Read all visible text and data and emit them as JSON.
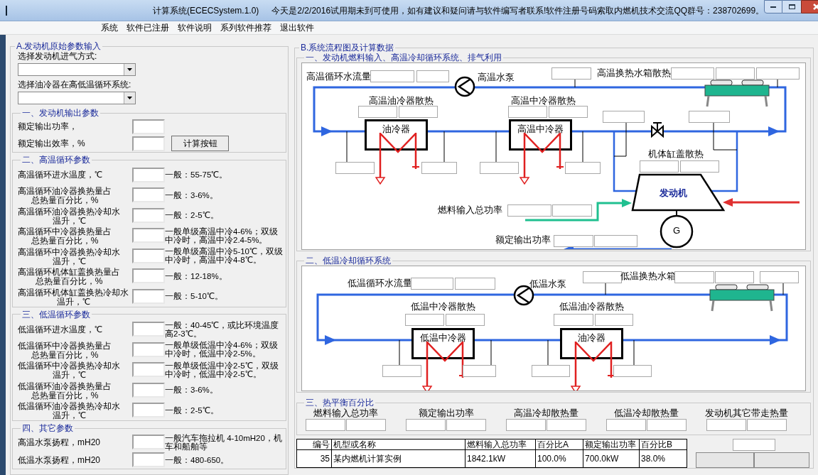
{
  "window": {
    "title": "计算系统(ECECSystem.1.0)",
    "notice": "今天是2/2/2016试用期未到可使用，如有建议和疑问请与软件编写者联系!软件注册号码索取内燃机技术交流QQ群号：238702699。"
  },
  "menu": [
    "系统",
    "软件已注册",
    "软件说明",
    "系列软件推荐",
    "退出软件"
  ],
  "input_panel": {
    "title": "A.发动机原始参数输入",
    "selects": [
      {
        "label": "选择发动机进气方式:"
      },
      {
        "label": "选择油冷器在高低温循环系统:"
      }
    ],
    "groups": [
      {
        "title": "一、发动机输出参数",
        "rows": [
          {
            "label": [
              "额定输出功率，"
            ]
          },
          {
            "label": [
              "额定输出效率，%"
            ],
            "button": "计算按钮"
          }
        ]
      },
      {
        "title": "二、高温循环参数",
        "rows": [
          {
            "label": [
              "高温循环进水温度，℃"
            ],
            "hint": "一般：55-75℃。"
          },
          {
            "label": [
              "高温循环油冷器换热量占",
              "总热量百分比，%"
            ],
            "hint": "一般：3-6%。"
          },
          {
            "label": [
              "高温循环油冷器换热冷却水",
              "温升，℃"
            ],
            "hint": "一般：2-5℃。"
          },
          {
            "label": [
              "高温循环中冷器换热量占",
              "总热量百分比，%"
            ],
            "hint": "一般单级高温中冷4-6%；双级中冷时，高温中冷2.4-5%。"
          },
          {
            "label": [
              "高温循环中冷器换热冷却水",
              "温升，℃"
            ],
            "hint": "一般单级高温中冷5-10℃，双级中冷时，高温中冷4-8℃。"
          },
          {
            "label": [
              "高温循环机体缸盖换热量占",
              "总热量百分比，%"
            ],
            "hint": "一般：12-18%。"
          },
          {
            "label": [
              "高温循环机体缸盖换热冷却水",
              "温升，℃"
            ],
            "hint": "一般：5-10℃。"
          }
        ]
      },
      {
        "title": "三、低温循环参数",
        "rows": [
          {
            "label": [
              "低温循环进水温度，℃"
            ],
            "hint": "一般：40-45℃，或比环境温度高2-3℃。"
          },
          {
            "label": [
              "低温循环中冷器换热量占",
              "总热量百分比，%"
            ],
            "hint": "一般单级低温中冷4-6%；双级中冷时，低温中冷2-5%。"
          },
          {
            "label": [
              "低温循环中冷器换热冷却水",
              "温升，℃"
            ],
            "hint": "一般单级低温中冷2-5℃，双级中冷时，低温中冷2-5℃。"
          },
          {
            "label": [
              "低温循环油冷器换热量占",
              "总热量百分比，%"
            ],
            "hint": "一般：3-6%。"
          },
          {
            "label": [
              "低温循环油冷器换热冷却水",
              "温升，℃"
            ],
            "hint": "一般：2-5℃。"
          }
        ]
      },
      {
        "title": "四、其它参数",
        "rows": [
          {
            "label": [
              "高温水泵扬程，mH20"
            ],
            "hint": "一般汽车拖拉机 4-10mH20，机车和船舶等"
          },
          {
            "label": [
              "低温水泵扬程，mH20"
            ],
            "hint": "一般：480-650。"
          }
        ]
      }
    ]
  },
  "diagram": {
    "title": "B.系统流程图及计算数据",
    "high_temp": {
      "title": "一、发动机燃料输入、高温冷却循环系统、排气利用",
      "flow_label": "高温循环水流量",
      "pump_label": "高温水泵",
      "radiator_label": "高温换热水箱散热",
      "cooler_1_label": "高温油冷器散热",
      "cooler_1_name": "油冷器",
      "cooler_2_label": "高温中冷器散热",
      "cooler_2_name": "高温中冷器",
      "block_label": "机体缸盖散热",
      "engine_name": "发动机",
      "fuel_label": "燃料输入总功率",
      "output_label": "额定输出功率",
      "generator": "G"
    },
    "low_temp": {
      "title": "二、低温冷却循环系统",
      "flow_label": "低温循环水流量",
      "pump_label": "低温水泵",
      "radiator_label": "低温换热水箱",
      "cooler_1_label": "低温中冷器散热",
      "cooler_1_name": "低温中冷器",
      "cooler_2_label": "低温油冷器散热",
      "cooler_2_name": "油冷器"
    },
    "heat_balance": {
      "title": "三、热平衡百分比",
      "items": [
        "燃料输入总功率",
        "额定输出功率",
        "高温冷却散热量",
        "低温冷却散热量",
        "发动机其它带走热量"
      ]
    }
  },
  "table": {
    "columns": [
      "编号",
      "机型或名称",
      "燃料输入总功率",
      "百分比A",
      "额定输出功率",
      "百分比B"
    ],
    "rows": [
      [
        "35",
        "某内燃机计算实例",
        "1842.1kW",
        "100.0%",
        "700.0kW",
        "38.0%"
      ]
    ]
  }
}
